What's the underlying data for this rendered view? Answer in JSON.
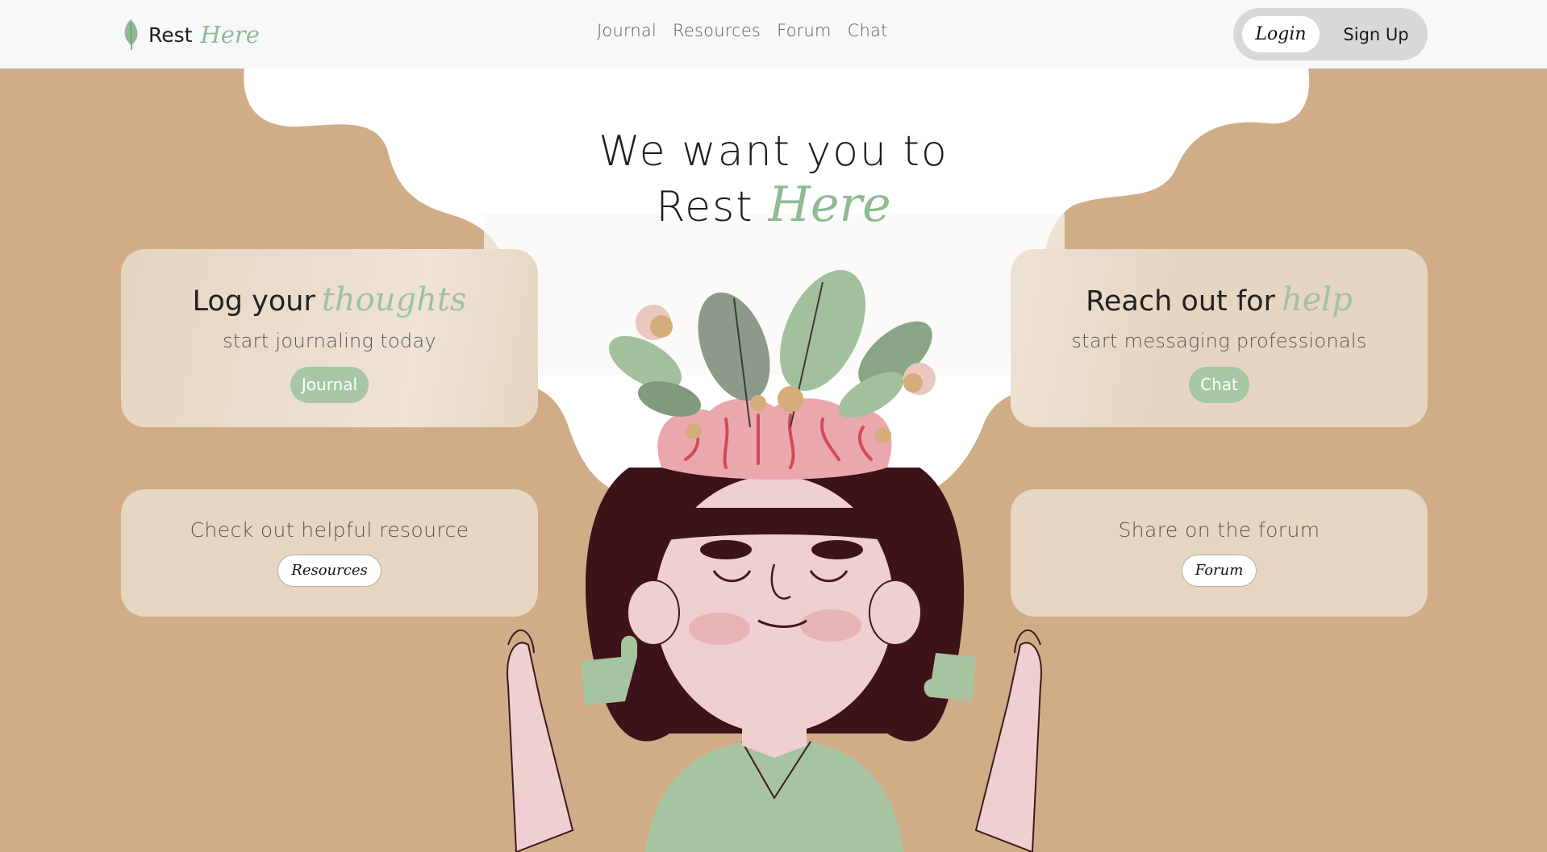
{
  "navbar": {
    "brand": {
      "rest": "Rest",
      "here": "Here",
      "icon": "leaf-icon"
    },
    "links": [
      "Journal",
      "Resources",
      "Forum",
      "Chat"
    ],
    "login_label": "Login",
    "signup_label": "Sign Up"
  },
  "hero": {
    "line1": "We want you to",
    "rest": "Rest",
    "here": "Here"
  },
  "cards": {
    "journal": {
      "title_plain": "Log your",
      "title_accent": "thoughts",
      "subtitle": "start journaling today",
      "button": "Journal"
    },
    "chat": {
      "title_plain": "Reach out for",
      "title_accent": "help",
      "subtitle": "start messaging professionals",
      "button": "Chat"
    },
    "resources": {
      "title": "Check out helpful resource",
      "button": "Resources"
    },
    "forum": {
      "title": "Share on the forum",
      "button": "Forum"
    }
  },
  "colors": {
    "background_tan": "#d0ad87",
    "accent_green": "#8fba93",
    "button_green": "#a7c7a4",
    "card_beige": "#e6d6c2",
    "navbar_bg": "#f7f8fa"
  },
  "illustration": {
    "subject": "girl-with-brain-and-plants",
    "icons": [
      "brain-icon",
      "leaf-icon",
      "flower-icon",
      "puzzle-piece-icon"
    ]
  }
}
